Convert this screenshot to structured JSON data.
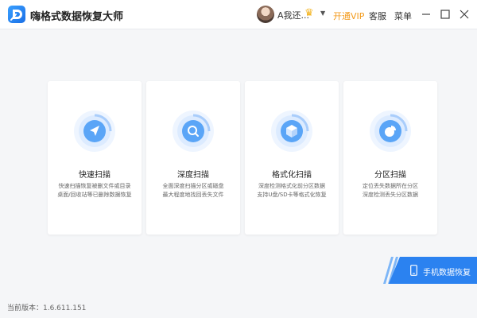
{
  "app": {
    "title": "嗨格式数据恢复大师",
    "icon": "logo-icon"
  },
  "header": {
    "username": "A我还...",
    "vip_label": "开通VIP",
    "service_label": "客服",
    "menu_label": "菜单",
    "colors": {
      "vip": "#f39a1b",
      "crown": "#f3b21b"
    }
  },
  "modes": [
    {
      "title": "快速扫描",
      "desc": [
        "快速扫描恢复被删文件或目录",
        "桌面/回收站等已删除数据恢复"
      ],
      "icon": "navigation-arrow-icon"
    },
    {
      "title": "深度扫描",
      "desc": [
        "全面深度扫描分区或磁盘",
        "最大程度地找回丢失文件"
      ],
      "icon": "magnifier-icon"
    },
    {
      "title": "格式化扫描",
      "desc": [
        "深度检测格式化前分区数据",
        "支持U盘/SD卡等格式化恢复"
      ],
      "icon": "cube-icon"
    },
    {
      "title": "分区扫描",
      "desc": [
        "定位丢失数据所在分区",
        "深度检测丢失分区数据"
      ],
      "icon": "pie-chart-icon"
    }
  ],
  "mobile_recovery": {
    "label": "手机数据恢复",
    "icon": "phone-icon",
    "color": "#2b82f0"
  },
  "footer": {
    "version": "当前版本：1.6.611.151"
  },
  "theme": {
    "accent": "#2b82f0",
    "background": "#f5f6f8"
  }
}
